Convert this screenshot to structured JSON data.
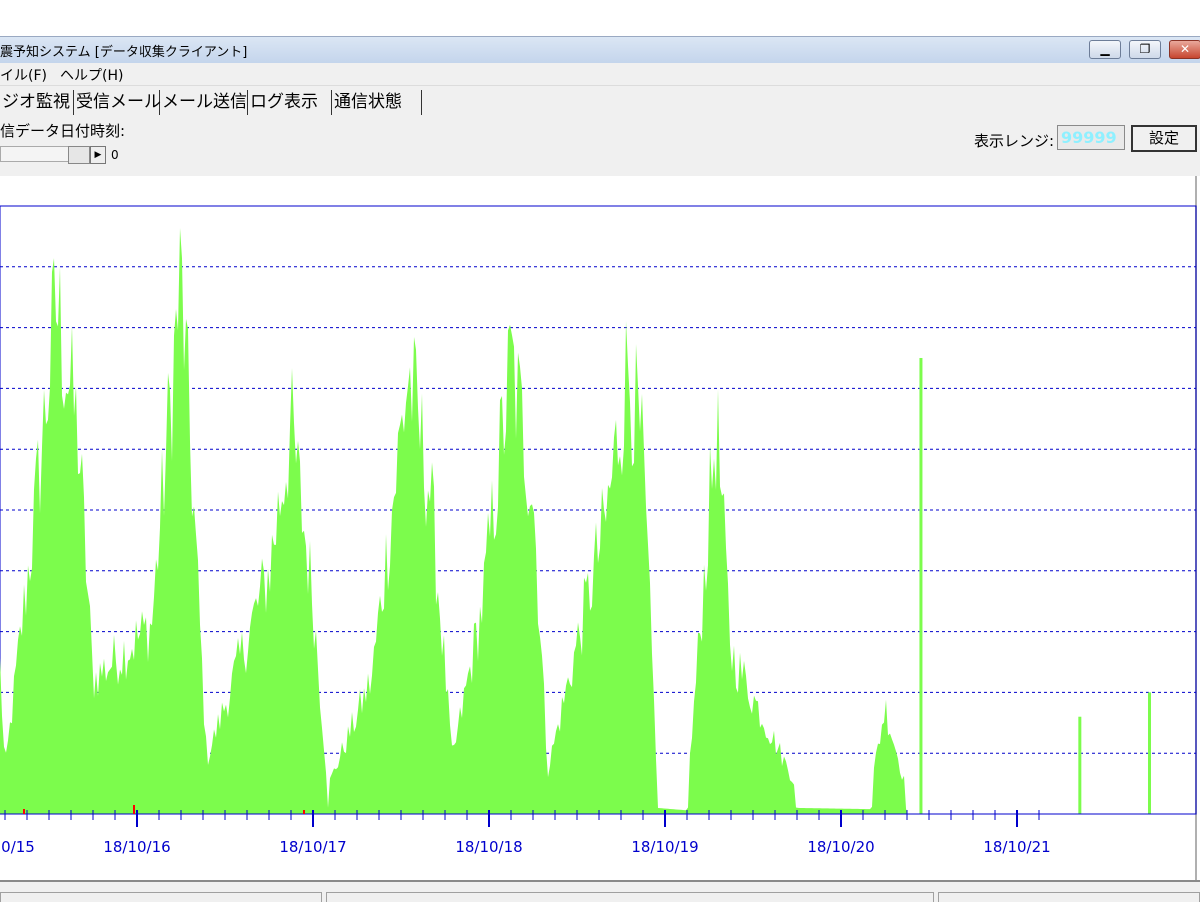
{
  "window": {
    "title": "震予知システム [データ収集クライアント]",
    "minimize_glyph": "▁",
    "maximize_glyph": "❐",
    "close_glyph": "✕"
  },
  "menu": {
    "items": [
      "イル(F)",
      "ヘルプ(H)"
    ]
  },
  "tabs": [
    "ジオ監視",
    "受信メール",
    "メール送信",
    "ログ表示",
    "通信状態"
  ],
  "controls": {
    "date_label": "信データ日付時刻:",
    "slider_value": "0",
    "slider_arrow": "▶",
    "range_label": "表示レンジ:",
    "range_value": "99999",
    "set_button": "設定"
  },
  "colors": {
    "bars": "#7cfc4c",
    "axis": "#0000cc",
    "grid": "#0000cc",
    "marker": "#ff0000"
  },
  "chart_data": {
    "type": "area",
    "x_tick_labels": [
      "0/15",
      "18/10/16",
      "18/10/17",
      "18/10/18",
      "18/10/19",
      "18/10/20",
      "18/10/21"
    ],
    "ylim": [
      0,
      99999
    ],
    "grid": "horizontal dashed",
    "series": [
      {
        "points": [
          [
            "18/10/15 00:00",
            40000
          ],
          [
            "18/10/15 02:00",
            90000
          ],
          [
            "18/10/15 04:00",
            65000
          ],
          [
            "18/10/15 06:00",
            8000
          ],
          [
            "18/10/15 10:00",
            55000
          ],
          [
            "18/10/15 13:00",
            95000
          ],
          [
            "18/10/15 16:00",
            70000
          ],
          [
            "18/10/15 18:00",
            25000
          ],
          [
            "18/10/16 02:00",
            35000
          ],
          [
            "18/10/16 06:00",
            100000
          ],
          [
            "18/10/16 08:00",
            50000
          ],
          [
            "18/10/16 09:30",
            10000
          ],
          [
            "18/10/16 18:00",
            45000
          ],
          [
            "18/10/16 21:00",
            72000
          ],
          [
            "18/10/17 00:00",
            40000
          ],
          [
            "18/10/17 02:00",
            5000
          ],
          [
            "18/10/17 08:00",
            25000
          ],
          [
            "18/10/17 13:00",
            82000
          ],
          [
            "18/10/17 16:00",
            60000
          ],
          [
            "18/10/17 19:00",
            10000
          ],
          [
            "18/10/17 23:00",
            38000
          ],
          [
            "18/10/18 03:00",
            84000
          ],
          [
            "18/10/18 06:00",
            60000
          ],
          [
            "18/10/18 08:00",
            8000
          ],
          [
            "18/10/18 16:00",
            55000
          ],
          [
            "18/10/18 19:00",
            84000
          ],
          [
            "18/10/18 21:00",
            65000
          ],
          [
            "18/10/18 23:00",
            5000
          ],
          [
            "18/10/19 03:00",
            3000
          ],
          [
            "18/10/19 07:00",
            73000
          ],
          [
            "18/10/19 09:00",
            30000
          ],
          [
            "18/10/19 18:00",
            5000
          ],
          [
            "18/10/20 04:00",
            4000
          ],
          [
            "18/10/20 06:00",
            20000
          ],
          [
            "18/10/20 09:00",
            4000
          ]
        ]
      }
    ]
  }
}
